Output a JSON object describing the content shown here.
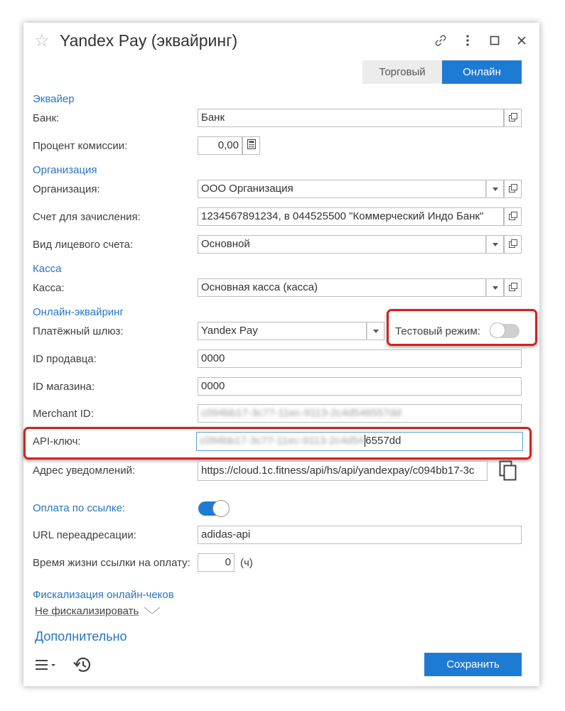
{
  "window": {
    "title": "Yandex Pay (эквайринг)"
  },
  "tabs": [
    {
      "label": "Торговый",
      "active": false
    },
    {
      "label": "Онлайн",
      "active": true
    }
  ],
  "sections": {
    "acquirer": "Эквайер",
    "organization": "Организация",
    "cashbox": "Касса",
    "online_acquiring": "Онлайн-эквайринг",
    "pay_by_link": "Оплата по ссылке:",
    "fiscalization": "Фискализация онлайн-чеков",
    "additional": "Дополнительно"
  },
  "fields": {
    "bank": {
      "label": "Банк:",
      "value": "Банк"
    },
    "commission": {
      "label": "Процент комиссии:",
      "value": "0,00"
    },
    "organization": {
      "label": "Организация:",
      "value": "ООО Организация"
    },
    "account": {
      "label": "Счет для зачисления:",
      "value": "1234567891234, в 044525500 \"Коммерческий Индо Банк\""
    },
    "personal_account_type": {
      "label": "Вид лицевого счета:",
      "value": "Основной"
    },
    "cashbox": {
      "label": "Касса:",
      "value": "Основная касса (касса)"
    },
    "gateway": {
      "label": "Платёжный шлюз:",
      "value": "Yandex Pay"
    },
    "test_mode": {
      "label": "Тестовый режим:",
      "enabled": false
    },
    "seller_id": {
      "label": "ID продавца:",
      "value": "0000"
    },
    "shop_id": {
      "label": "ID магазина:",
      "value": "0000"
    },
    "merchant_id": {
      "label": "Merchant ID:",
      "value_blurred": "c094bb17-3c77-11ec-9113-2c4d546557dd"
    },
    "api_key": {
      "label": "API-ключ:",
      "value_blurred": "c094bb17-3c77-11ec-9113-2c4d54",
      "value_visible": "6557dd"
    },
    "notify_url": {
      "label": "Адрес уведомлений:",
      "value": "https://cloud.1c.fitness/api/hs/api/yandexpay/c094bb17-3c"
    },
    "pay_by_link_enabled": true,
    "redirect_url": {
      "label": "URL переадресации:",
      "value": "adidas-api"
    },
    "link_lifetime": {
      "label": "Время жизни ссылки на оплату:",
      "value": "0",
      "unit": "(ч)"
    },
    "fiscalization_mode": {
      "value": "Не фискализировать"
    }
  },
  "footer": {
    "save_label": "Сохранить"
  },
  "colors": {
    "accent": "#1e7bd3",
    "section_text": "#2675c4",
    "highlight_border": "#d52020"
  }
}
